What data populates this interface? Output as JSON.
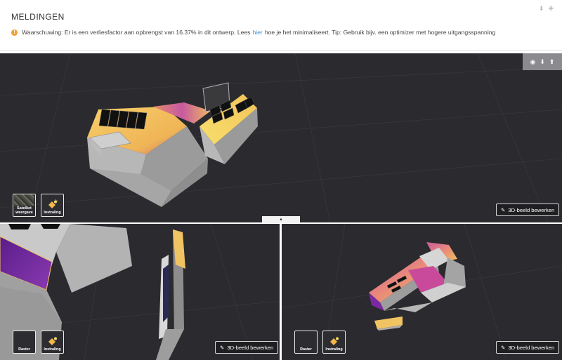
{
  "notifications": {
    "title": "MELDINGEN",
    "warning_prefix": "Waarschuwing: Er is een verliesfactor aan opbrengst van 16.37% in dit ontwerp. Lees",
    "warning_link": "hier",
    "warning_suffix": "hoe je het minimaliseert. Tip: Gebruik bijv. een optimizer met hogere uitgangsspanning",
    "colors": {
      "warning": "#f0a030",
      "link": "#3a8fd6"
    }
  },
  "viewports": {
    "top": {
      "thumb_satellite_label": "Satelliet weergave",
      "thumb_irradiation_label": "Instraling",
      "edit_label": "3D-beeld bewerken",
      "icons": [
        "record-icon",
        "arrow-down-icon",
        "arrow-up-icon"
      ]
    },
    "bottom_left": {
      "thumb_grid_label": "Raster",
      "thumb_irradiation_label": "Instraling",
      "edit_label": "3D-beeld bewerken"
    },
    "bottom_right": {
      "thumb_grid_label": "Raster",
      "thumb_irradiation_label": "Instraling",
      "edit_label": "3D-beeld bewerken"
    }
  },
  "theme": {
    "viewport_bg": "#2b2b2f",
    "roof_warm": "#f2c35a",
    "roof_cool": "#7a2aa0",
    "wall": "#9a9a9a"
  }
}
